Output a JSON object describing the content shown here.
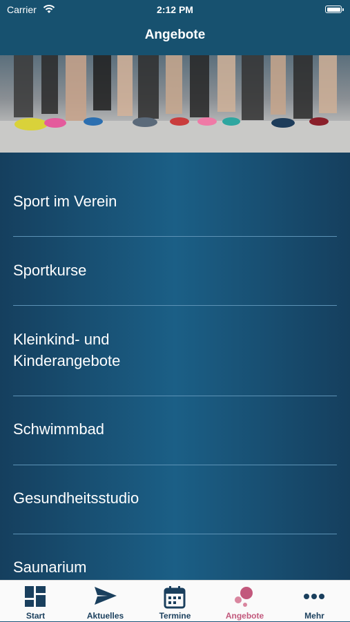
{
  "status_bar": {
    "carrier": "Carrier",
    "time": "2:12 PM"
  },
  "header": {
    "title": "Angebote"
  },
  "banner": {
    "image": "runners-feet-photo"
  },
  "menu": {
    "items": [
      {
        "label": "Sport im Verein"
      },
      {
        "label": "Sportkurse"
      },
      {
        "label": "Kleinkind- und\nKinderangebote"
      },
      {
        "label": "Schwimmbad"
      },
      {
        "label": "Gesundheitsstudio"
      },
      {
        "label": "Saunarium"
      }
    ]
  },
  "tabbar": {
    "tabs": [
      {
        "label": "Start",
        "icon": "grid-icon"
      },
      {
        "label": "Aktuelles",
        "icon": "send-icon"
      },
      {
        "label": "Termine",
        "icon": "calendar-icon"
      },
      {
        "label": "Angebote",
        "icon": "dots-bubble-icon",
        "active": true
      },
      {
        "label": "Mehr",
        "icon": "more-icon"
      }
    ]
  },
  "colors": {
    "header": "#17516f",
    "tab_active": "#c2587c",
    "tab_inactive": "#1a3f5d"
  }
}
